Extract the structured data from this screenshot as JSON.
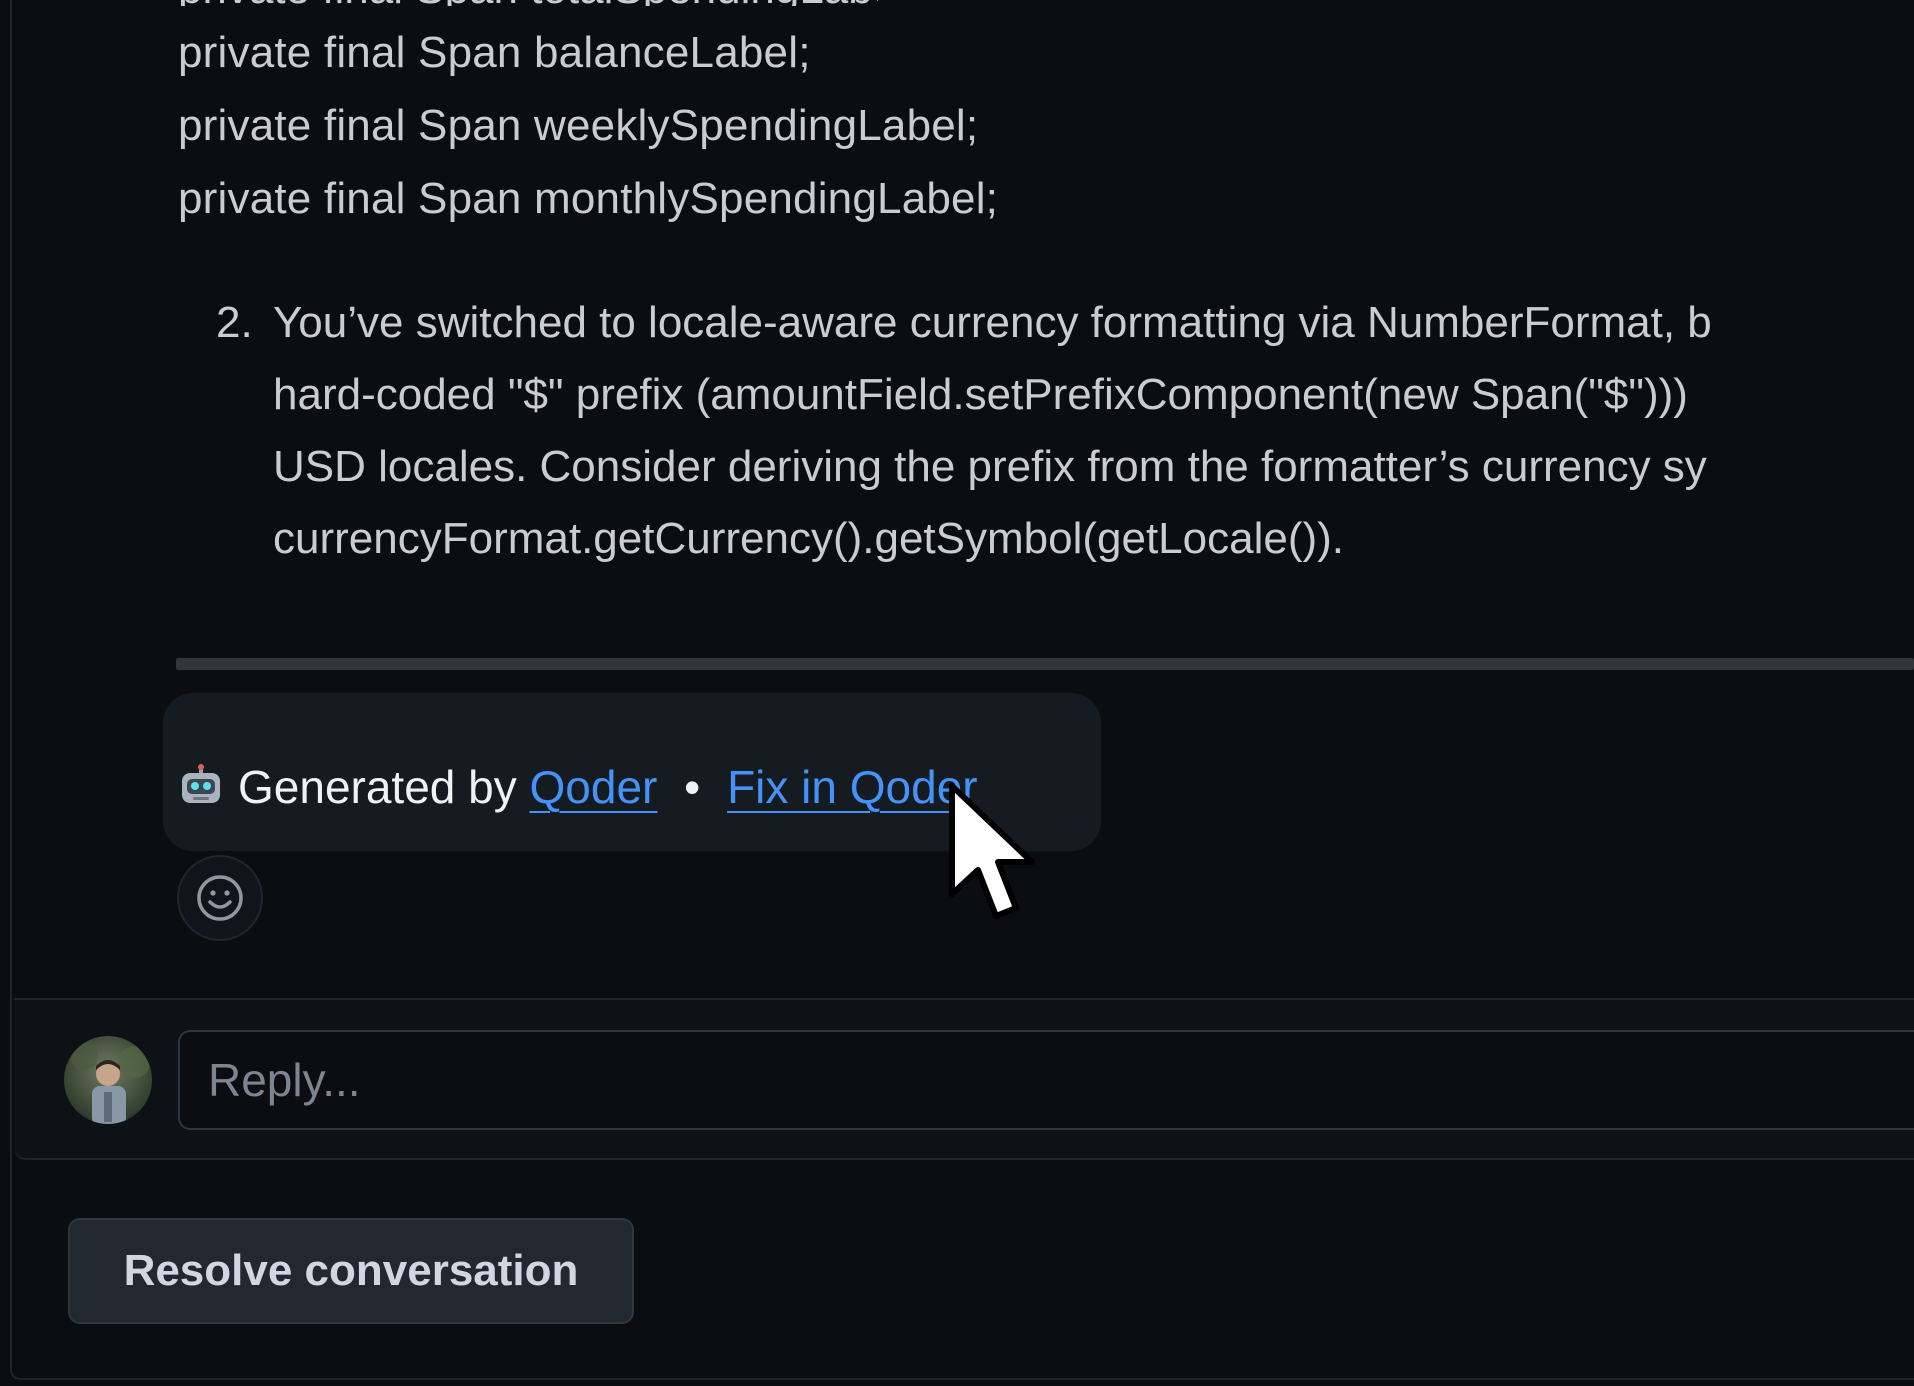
{
  "code": {
    "lines": [
      "private final Span balanceLabel;",
      "private final Span weeklySpendingLabel;",
      "private final Span monthlySpendingLabel;"
    ]
  },
  "suggestion": {
    "number": "2.",
    "lines": [
      "You’ve switched to locale-aware currency formatting via NumberFormat, b",
      "hard-coded \"$\" prefix (amountField.setPrefixComponent(new Span(\"$\")))",
      "USD locales. Consider deriving the prefix from the formatter’s currency sy",
      "currencyFormat.getCurrency().getSymbol(getLocale())."
    ]
  },
  "footer": {
    "icon": "robot-icon",
    "generated_by": "Generated by",
    "qoder_link": "Qoder",
    "separator": "•",
    "fix_link": "Fix in Qoder"
  },
  "reactions": {
    "icon": "smiley-icon"
  },
  "reply": {
    "placeholder": "Reply...",
    "value": ""
  },
  "resolve": {
    "label": "Resolve conversation"
  },
  "colors": {
    "background": "#0b0d11",
    "link": "#4493f8",
    "text": "#c9ccd1"
  }
}
